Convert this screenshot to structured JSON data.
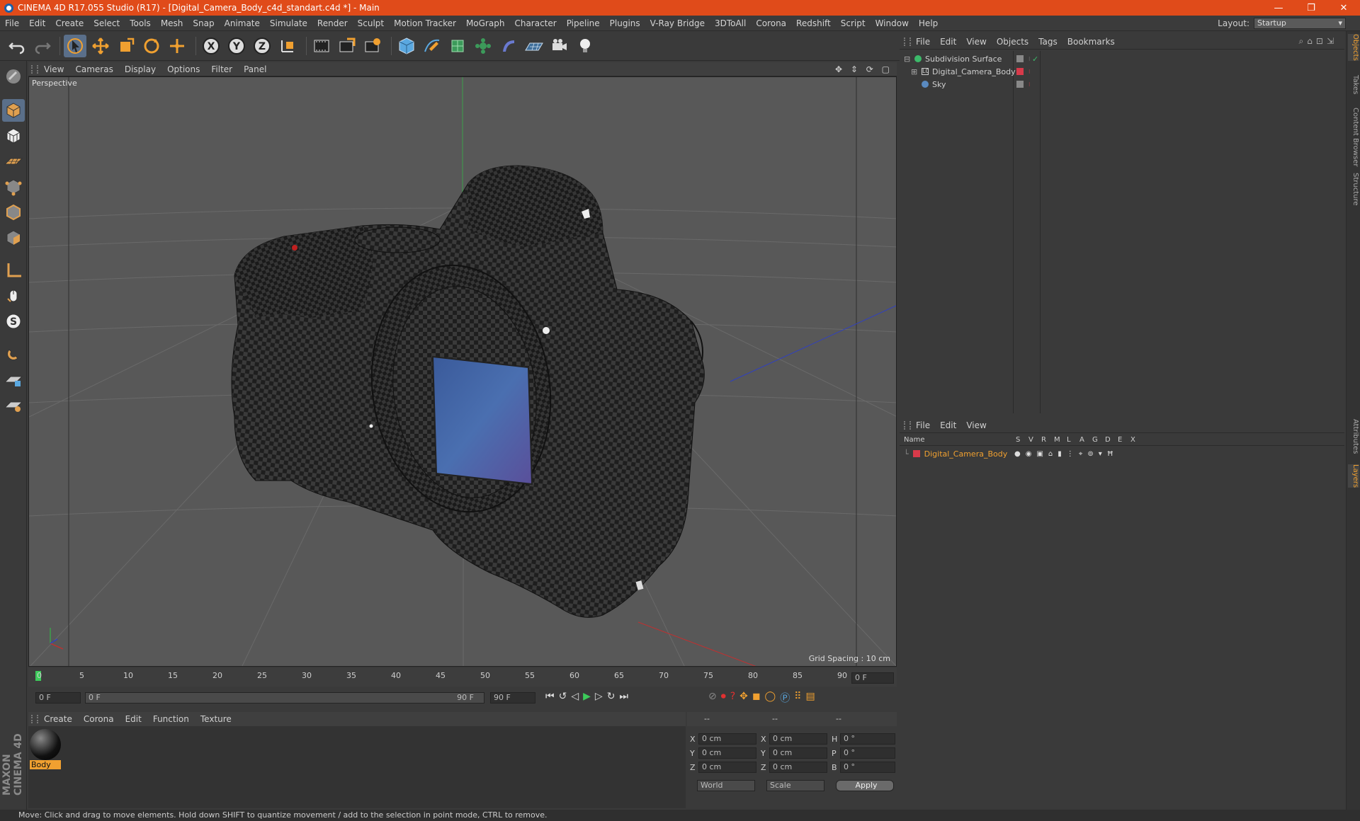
{
  "window": {
    "title": "CINEMA 4D R17.055 Studio (R17) - [Digital_Camera_Body_c4d_standart.c4d *] - Main",
    "controls": [
      "—",
      "❐",
      "✕"
    ]
  },
  "menu": [
    "File",
    "Edit",
    "Create",
    "Select",
    "Tools",
    "Mesh",
    "Snap",
    "Animate",
    "Simulate",
    "Render",
    "Sculpt",
    "Motion Tracker",
    "MoGraph",
    "Character",
    "Pipeline",
    "Plugins",
    "V-Ray Bridge",
    "3DToAll",
    "Corona",
    "Redshift",
    "Script",
    "Window",
    "Help"
  ],
  "layout": {
    "label": "Layout:",
    "value": "Startup"
  },
  "viewport": {
    "menu": [
      "View",
      "Cameras",
      "Display",
      "Options",
      "Filter",
      "Panel"
    ],
    "label": "Perspective",
    "grid_spacing": "Grid Spacing : 10 cm"
  },
  "timeline": {
    "ticks": [
      "0",
      "5",
      "10",
      "15",
      "20",
      "25",
      "30",
      "35",
      "40",
      "45",
      "50",
      "55",
      "60",
      "65",
      "70",
      "75",
      "80",
      "85",
      "90"
    ],
    "frame_field": "0 F",
    "start": "0 F",
    "range_start": "0 F",
    "range_end": "90 F",
    "end": "90 F"
  },
  "material": {
    "menu": [
      "Create",
      "Corona",
      "Edit",
      "Function",
      "Texture"
    ],
    "items": [
      {
        "label": "Body"
      }
    ]
  },
  "coords": {
    "headers": [
      "--",
      "--",
      "--"
    ],
    "rows": [
      {
        "a": "X",
        "av": "0 cm",
        "b": "X",
        "bv": "0 cm",
        "c": "H",
        "cv": "0 °"
      },
      {
        "a": "Y",
        "av": "0 cm",
        "b": "Y",
        "bv": "0 cm",
        "c": "P",
        "cv": "0 °"
      },
      {
        "a": "Z",
        "av": "0 cm",
        "b": "Z",
        "bv": "0 cm",
        "c": "B",
        "cv": "0 °"
      }
    ],
    "mode1": "World",
    "mode2": "Scale",
    "apply": "Apply"
  },
  "objects": {
    "menu": [
      "File",
      "Edit",
      "View",
      "Objects",
      "Tags",
      "Bookmarks"
    ],
    "items": [
      {
        "name": "Subdivision Surface"
      },
      {
        "name": "Digital_Camera_Body"
      },
      {
        "name": "Sky"
      }
    ]
  },
  "layers": {
    "menu": [
      "File",
      "Edit",
      "View"
    ],
    "columns": [
      "Name",
      "S",
      "V",
      "R",
      "M",
      "L",
      "A",
      "G",
      "D",
      "E",
      "X"
    ],
    "items": [
      {
        "name": "Digital_Camera_Body"
      }
    ]
  },
  "righttabs": [
    "Objects",
    "Takes",
    "Content Browser",
    "Structure",
    "Attributes",
    "Layers"
  ],
  "status": "Move: Click and drag to move elements. Hold down SHIFT to quantize movement / add to the selection in point mode, CTRL to remove.",
  "maxon": "MAXON CINEMA 4D",
  "colors": {
    "titlebar": "#e04b1a",
    "accent": "#f0a030",
    "layer": "#d83a4a"
  }
}
